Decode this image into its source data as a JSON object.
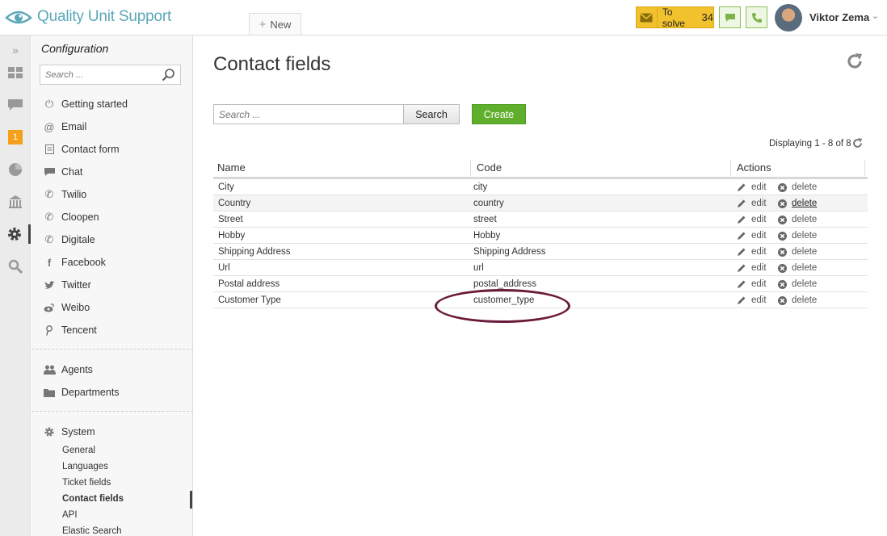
{
  "header": {
    "logo_text": "Quality Unit Support",
    "new_tab_label": "New",
    "to_solve_label": "To solve",
    "to_solve_count": "34",
    "user_name": "Viktor Zema"
  },
  "rail": {
    "badge_count": "1"
  },
  "sidebar": {
    "title": "Configuration",
    "search_placeholder": "Search ...",
    "channels": [
      {
        "label": "Getting started",
        "icon": "power-icon"
      },
      {
        "label": "Email",
        "icon": "at-icon"
      },
      {
        "label": "Contact form",
        "icon": "form-icon"
      },
      {
        "label": "Chat",
        "icon": "chat-icon"
      },
      {
        "label": "Twilio",
        "icon": "phone-icon"
      },
      {
        "label": "Cloopen",
        "icon": "phone-icon"
      },
      {
        "label": "Digitale",
        "icon": "phone-icon"
      },
      {
        "label": "Facebook",
        "icon": "facebook-icon"
      },
      {
        "label": "Twitter",
        "icon": "twitter-icon"
      },
      {
        "label": "Weibo",
        "icon": "weibo-icon"
      },
      {
        "label": "Tencent",
        "icon": "tencent-icon"
      }
    ],
    "people": [
      {
        "label": "Agents",
        "icon": "agents-icon"
      },
      {
        "label": "Departments",
        "icon": "folder-icon"
      }
    ],
    "system_label": "System",
    "system_items": [
      "General",
      "Languages",
      "Ticket fields",
      "Contact fields",
      "API",
      "Elastic Search"
    ],
    "active_system_item": "Contact fields"
  },
  "main": {
    "title": "Contact fields",
    "search_placeholder": "Search ...",
    "search_button": "Search",
    "create_button": "Create",
    "displaying": "Displaying 1 - 8 of 8",
    "columns": [
      "Name",
      "Code",
      "Actions"
    ],
    "edit_label": "edit",
    "delete_label": "delete",
    "rows": [
      {
        "name": "City",
        "code": "city"
      },
      {
        "name": "Country",
        "code": "country"
      },
      {
        "name": "Street",
        "code": "street"
      },
      {
        "name": "Hobby",
        "code": "Hobby"
      },
      {
        "name": "Shipping Address",
        "code": "Shipping Address"
      },
      {
        "name": "Url",
        "code": "url"
      },
      {
        "name": "Postal address",
        "code": "postal_address"
      },
      {
        "name": "Customer Type",
        "code": "customer_type"
      }
    ]
  },
  "colors": {
    "accent_green": "#5fae2c",
    "to_solve_yellow": "#f2c12e",
    "badge_orange": "#f4a01b",
    "annotation_ellipse": "#6b1a3a"
  }
}
